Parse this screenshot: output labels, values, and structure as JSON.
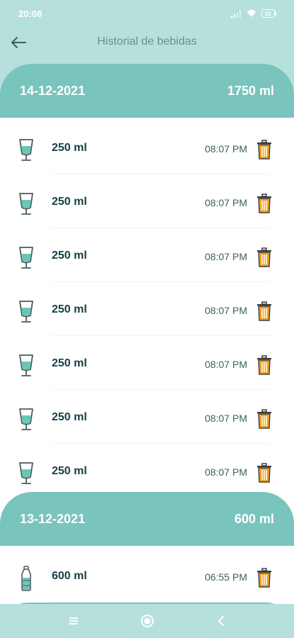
{
  "status_bar": {
    "time": "20:08",
    "battery": "82",
    "icons": [
      "signal-icon",
      "wifi-icon",
      "battery-icon"
    ]
  },
  "app_bar": {
    "title": "Historial de bebidas",
    "back_icon": "back-arrow-icon"
  },
  "days": [
    {
      "date": "14-12-2021",
      "total": "1750 ml",
      "drinks": [
        {
          "amount": "250 ml",
          "time": "08:07 PM",
          "icon": "glass-icon"
        },
        {
          "amount": "250 ml",
          "time": "08:07 PM",
          "icon": "glass-icon"
        },
        {
          "amount": "250 ml",
          "time": "08:07 PM",
          "icon": "glass-icon"
        },
        {
          "amount": "250 ml",
          "time": "08:07 PM",
          "icon": "glass-icon"
        },
        {
          "amount": "250 ml",
          "time": "08:07 PM",
          "icon": "glass-icon"
        },
        {
          "amount": "250 ml",
          "time": "08:07 PM",
          "icon": "glass-icon"
        },
        {
          "amount": "250 ml",
          "time": "08:07 PM",
          "icon": "glass-icon"
        }
      ]
    },
    {
      "date": "13-12-2021",
      "total": "600 ml",
      "drinks": [
        {
          "amount": "600 ml",
          "time": "06:55 PM",
          "icon": "bottle-icon"
        }
      ]
    }
  ],
  "nav_bar": {
    "icons": [
      "menu-icon",
      "home-icon",
      "back-icon"
    ]
  },
  "colors": {
    "header_bg": "#b6e0dc",
    "day_header": "#79c4bd",
    "water": "#6cc6b8",
    "trash": "#f2a11f"
  }
}
